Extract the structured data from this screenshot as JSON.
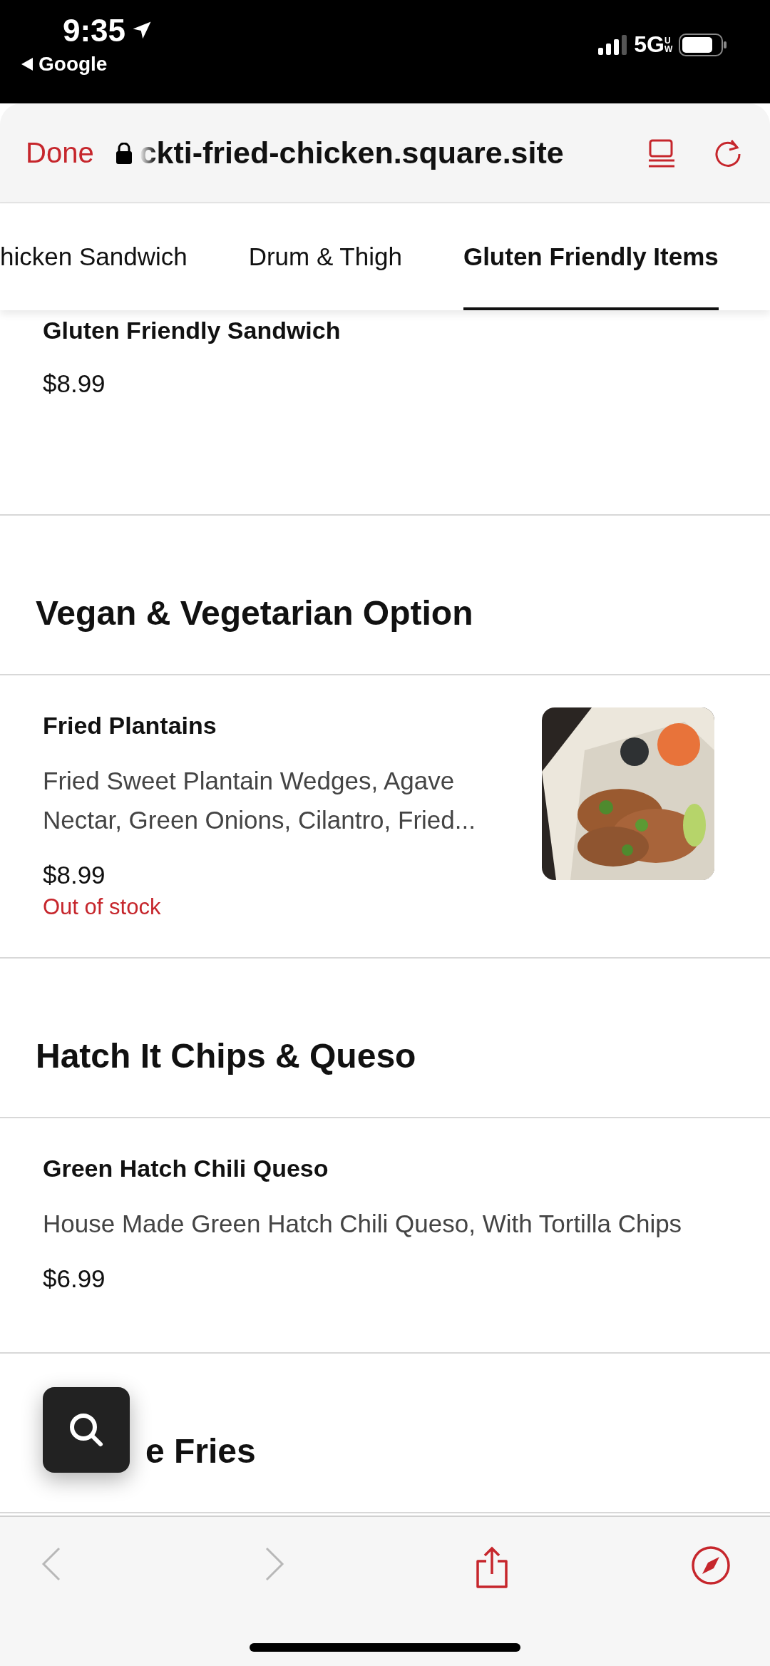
{
  "status_bar": {
    "time": "9:35",
    "back_app": "Google",
    "network": "5G",
    "network_badge": "UW"
  },
  "browser": {
    "done": "Done",
    "url": "ckti-fried-chicken.square.site"
  },
  "tabs": [
    {
      "label": "hicken Sandwich",
      "selected": false
    },
    {
      "label": "Drum & Thigh",
      "selected": false
    },
    {
      "label": "Gluten Friendly Items",
      "selected": true
    }
  ],
  "menu": [
    {
      "kind": "item",
      "name": "Gluten Friendly Sandwich",
      "price": "$8.99"
    },
    {
      "kind": "heading",
      "title": "Vegan & Vegetarian Option"
    },
    {
      "kind": "item",
      "name": "Fried Plantains",
      "description": "Fried Sweet Plantain Wedges, Agave Nectar, Green Onions, Cilantro, Fried...",
      "price": "$8.99",
      "stock": "Out of stock"
    },
    {
      "kind": "heading",
      "title": "Hatch It Chips & Queso"
    },
    {
      "kind": "item",
      "name": "Green Hatch Chili Queso",
      "description": "House Made Green Hatch Chili Queso, With Tortilla Chips",
      "price": "$6.99"
    },
    {
      "kind": "heading",
      "title": "e Fries",
      "covered": true
    }
  ],
  "toolbar": {
    "back_disabled": true,
    "forward_disabled": true
  }
}
